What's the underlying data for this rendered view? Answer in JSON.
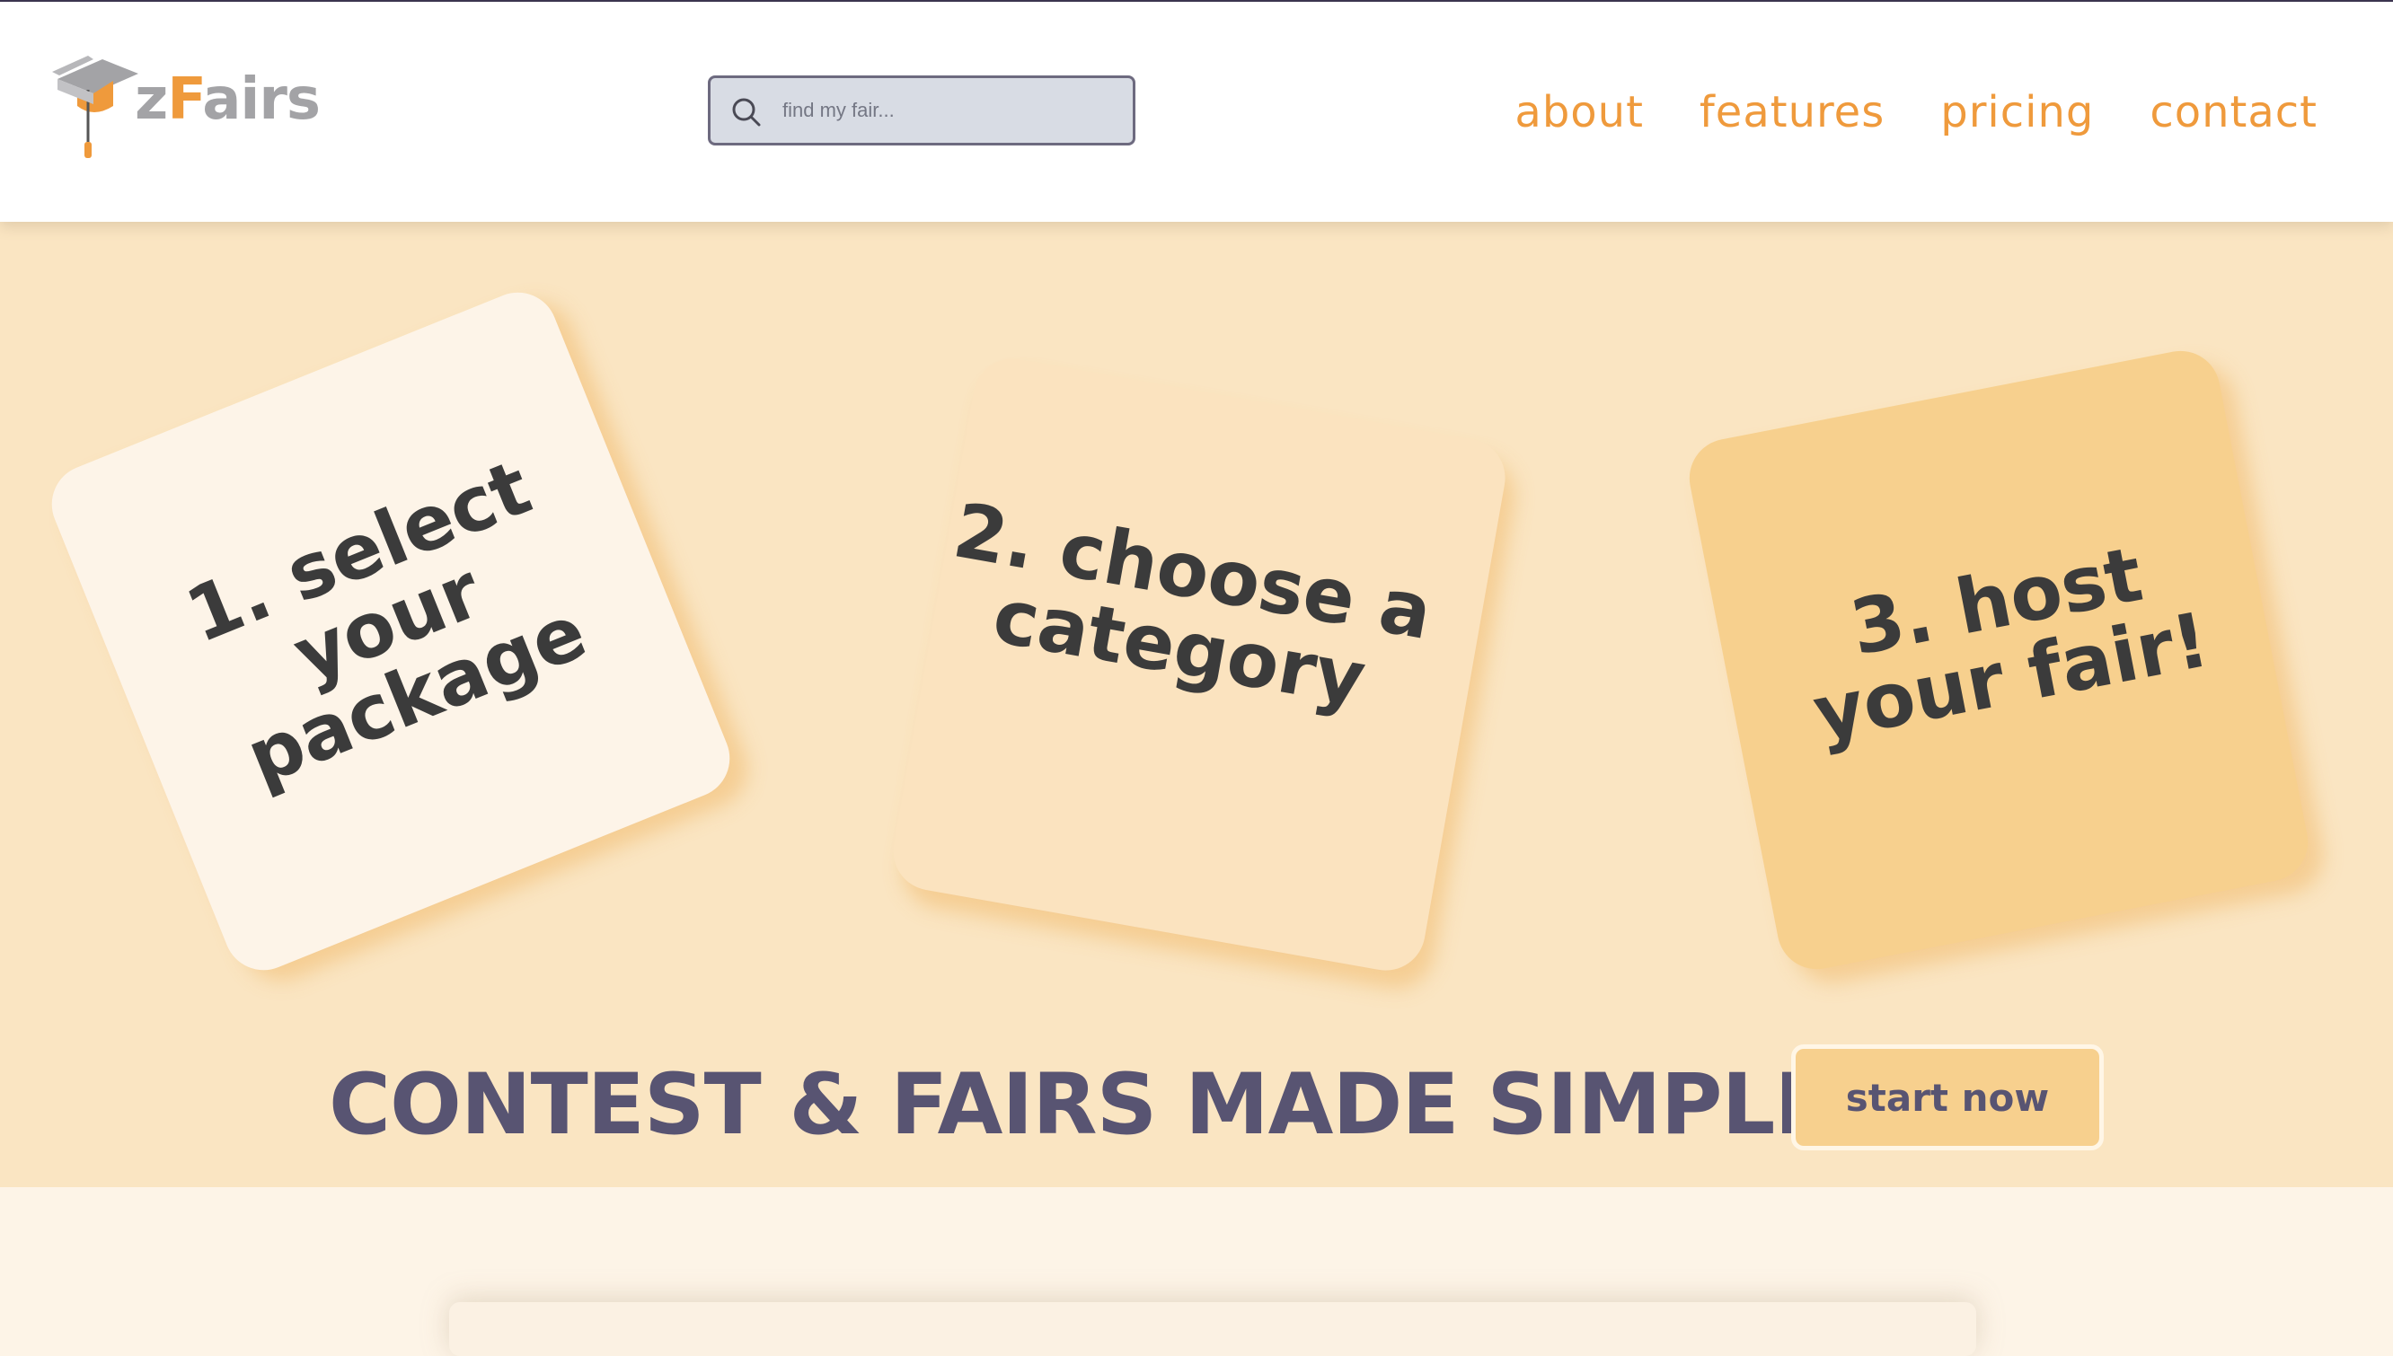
{
  "brand": {
    "logo_z": "z",
    "logo_f": "F",
    "logo_rest": "airs",
    "accent_color": "#ef9a3c",
    "gray_color": "#a3a3a6"
  },
  "search": {
    "placeholder": "find my fair...",
    "value": "",
    "icon": "search-icon"
  },
  "nav": {
    "items": [
      {
        "label": "about"
      },
      {
        "label": "features"
      },
      {
        "label": "pricing"
      },
      {
        "label": "contact"
      }
    ]
  },
  "hero": {
    "background_color": "#fae5c2",
    "cards": [
      {
        "label": "1. select your package",
        "color": "#fdf4e8"
      },
      {
        "label": "2. choose a category",
        "color": "#fbe3bf"
      },
      {
        "label": "3. host your fair!",
        "color": "#f7d08e"
      }
    ],
    "tagline": "CONTEST & FAIRS MADE SIMPLE!",
    "tagline_color": "#585472",
    "cta_label": "start now"
  }
}
